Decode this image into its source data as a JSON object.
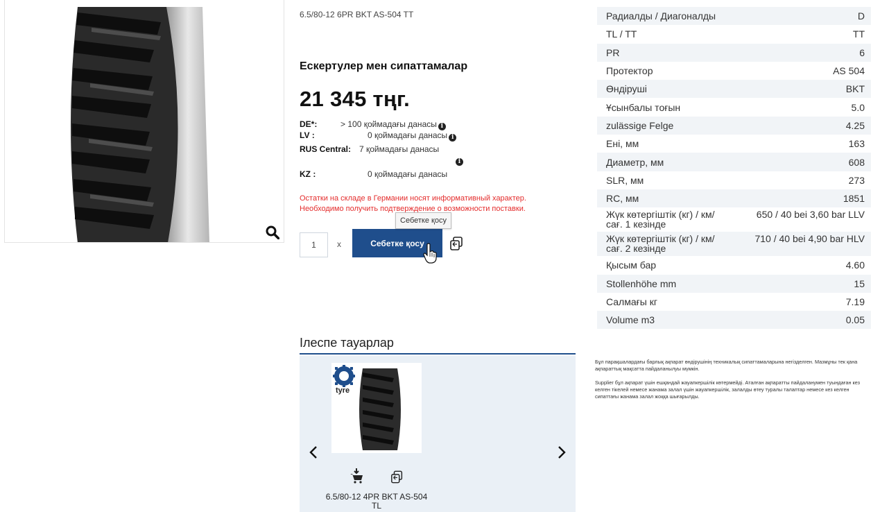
{
  "product": {
    "sku_line": "6.5/80-12 6PR BKT AS-504 TT",
    "section_title": "Ескертулер мен сипаттамалар",
    "price": "21 345 тңг."
  },
  "stock": [
    {
      "key": "DE*:",
      "value": "> 100 қоймадағы данасы"
    },
    {
      "key": "LV :",
      "value": "0 қоймадағы данасы"
    },
    {
      "key": "RUS Central:",
      "value": "7 қоймадағы данасы"
    },
    {
      "key": "KZ :",
      "value": "0 қоймадағы данасы"
    }
  ],
  "info_icon_glyph": "i",
  "warning": {
    "line1": "Остатки на складе в Германии носят информативный характер.",
    "line2": "Необходимо получить подтверждение о возможности поставки."
  },
  "cart": {
    "quantity": "1",
    "times": "x",
    "button_label": "Себетке қосу",
    "tooltip": "Себетке қосу"
  },
  "related": {
    "title": "Ілеспе тауарлар",
    "brand_label": "tyre",
    "item_name": "6.5/80-12 4PR BKT AS-504 TL"
  },
  "specs": [
    {
      "label": "Радиалды / Диагоналды",
      "value": "D"
    },
    {
      "label": "TL / TT",
      "value": "TT"
    },
    {
      "label": "PR",
      "value": "6"
    },
    {
      "label": "Протектор",
      "value": "AS 504"
    },
    {
      "label": "Өндіруші",
      "value": "BKT"
    },
    {
      "label": "Ұсынбалы тоғын",
      "value": "5.0"
    },
    {
      "label": "zulässige Felge",
      "value": "4.25"
    },
    {
      "label": "Ені, мм",
      "value": "163"
    },
    {
      "label": "Диаметр, мм",
      "value": "608"
    },
    {
      "label": "SLR, мм",
      "value": "273"
    },
    {
      "label": "RC, мм",
      "value": "1851"
    },
    {
      "label": "Жүк көтергіштік (кг) / км/сағ. 1 кезінде",
      "value": "650 / 40 bei 3,60 bar LLV"
    },
    {
      "label": "Жүк көтергіштік (кг) / км/сағ. 2 кезінде",
      "value": "710 / 40 bei 4,90 bar HLV"
    },
    {
      "label": "Қысым бар",
      "value": "4.60"
    },
    {
      "label": "Stollenhöhe mm",
      "value": "15"
    },
    {
      "label": "Салмағы кг",
      "value": "7.19"
    },
    {
      "label": "Volume m3",
      "value": "0.05"
    }
  ],
  "disclaimer": {
    "p1": "Бұл парақшалардағы барлық ақпарат өндірушінің техникалық сипаттамаларына негізделген. Мазмұны тек қана ақпараттық мақсатта пайдаланылуы мүмкін.",
    "p2": "Supplier бұл ақпарат үшін ешқандай жауапкершілік көтермейді. Аталған ақпаратты пайдаланумен туындаған кез келген тікелей немесе жанама залал үшін жауапкершілік, залалды өтеу туралы талаптар немесе кез келген сипаттағы жанама залал жоққа шығарылды."
  },
  "colors": {
    "primary": "#1f4e8c",
    "warning": "#e42c2c",
    "table_stripe": "#f1f4f7",
    "related_bg": "#eaf0f6"
  }
}
